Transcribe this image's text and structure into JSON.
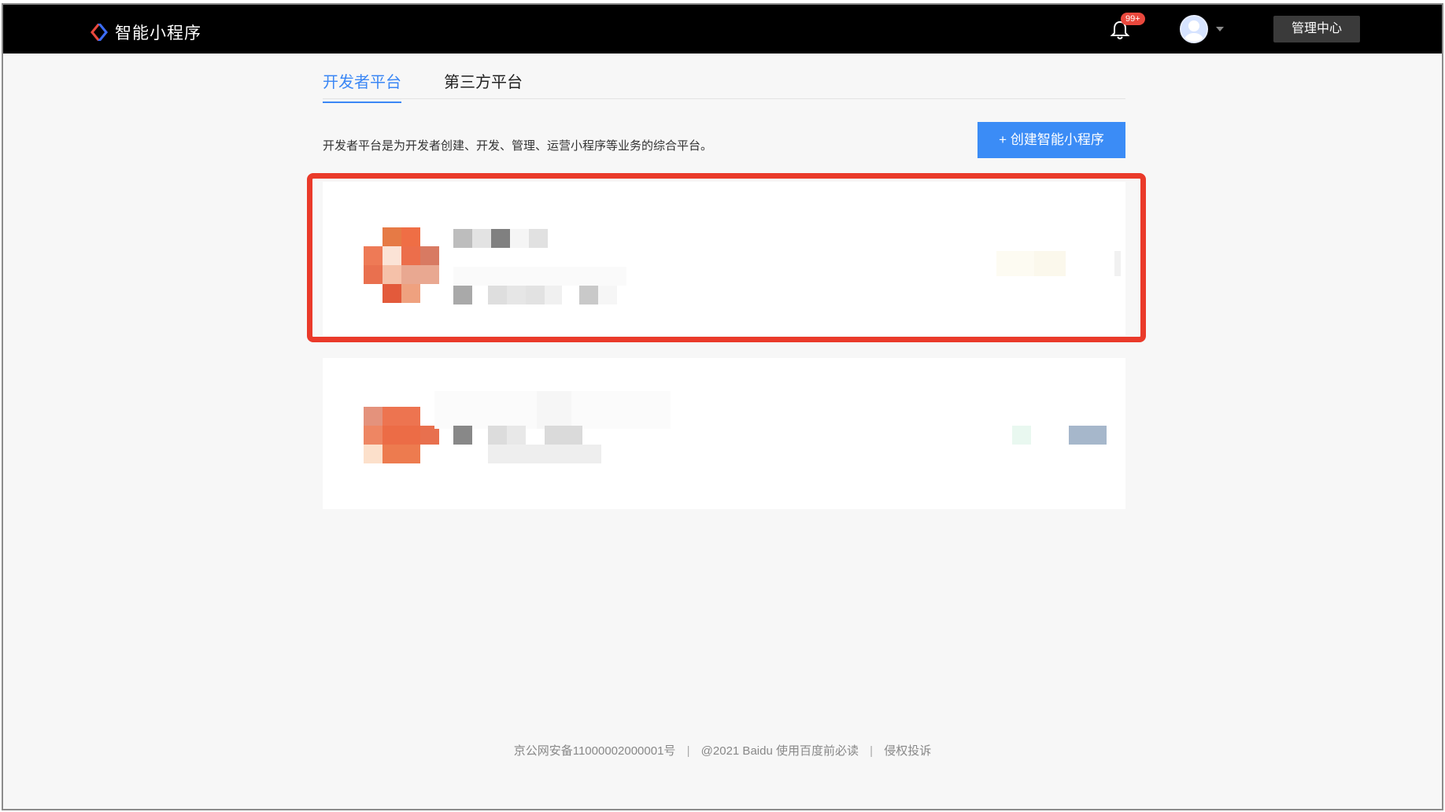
{
  "app": {
    "title": "智能小程序",
    "brand_colors": {
      "blue": "#3b87f5",
      "red": "#e9483d"
    }
  },
  "header": {
    "notifications_badge": "99+",
    "admin_button": "管理中心"
  },
  "tabs": [
    {
      "label": "开发者平台",
      "active": true
    },
    {
      "label": "第三方平台",
      "active": false
    }
  ],
  "main": {
    "description": "开发者平台是为开发者创建、开发、管理、运营小程序等业务的综合平台。",
    "create_button": "+ 创建智能小程序"
  },
  "cards": [
    {
      "icon": "app-icon",
      "highlighted": true
    },
    {
      "icon": "app-icon",
      "highlighted": false
    }
  ],
  "footer": {
    "icp": "京公网安备11000002000001号",
    "copyright": "@2021 Baidu",
    "terms": "使用百度前必读",
    "complaint": "侵权投诉"
  }
}
